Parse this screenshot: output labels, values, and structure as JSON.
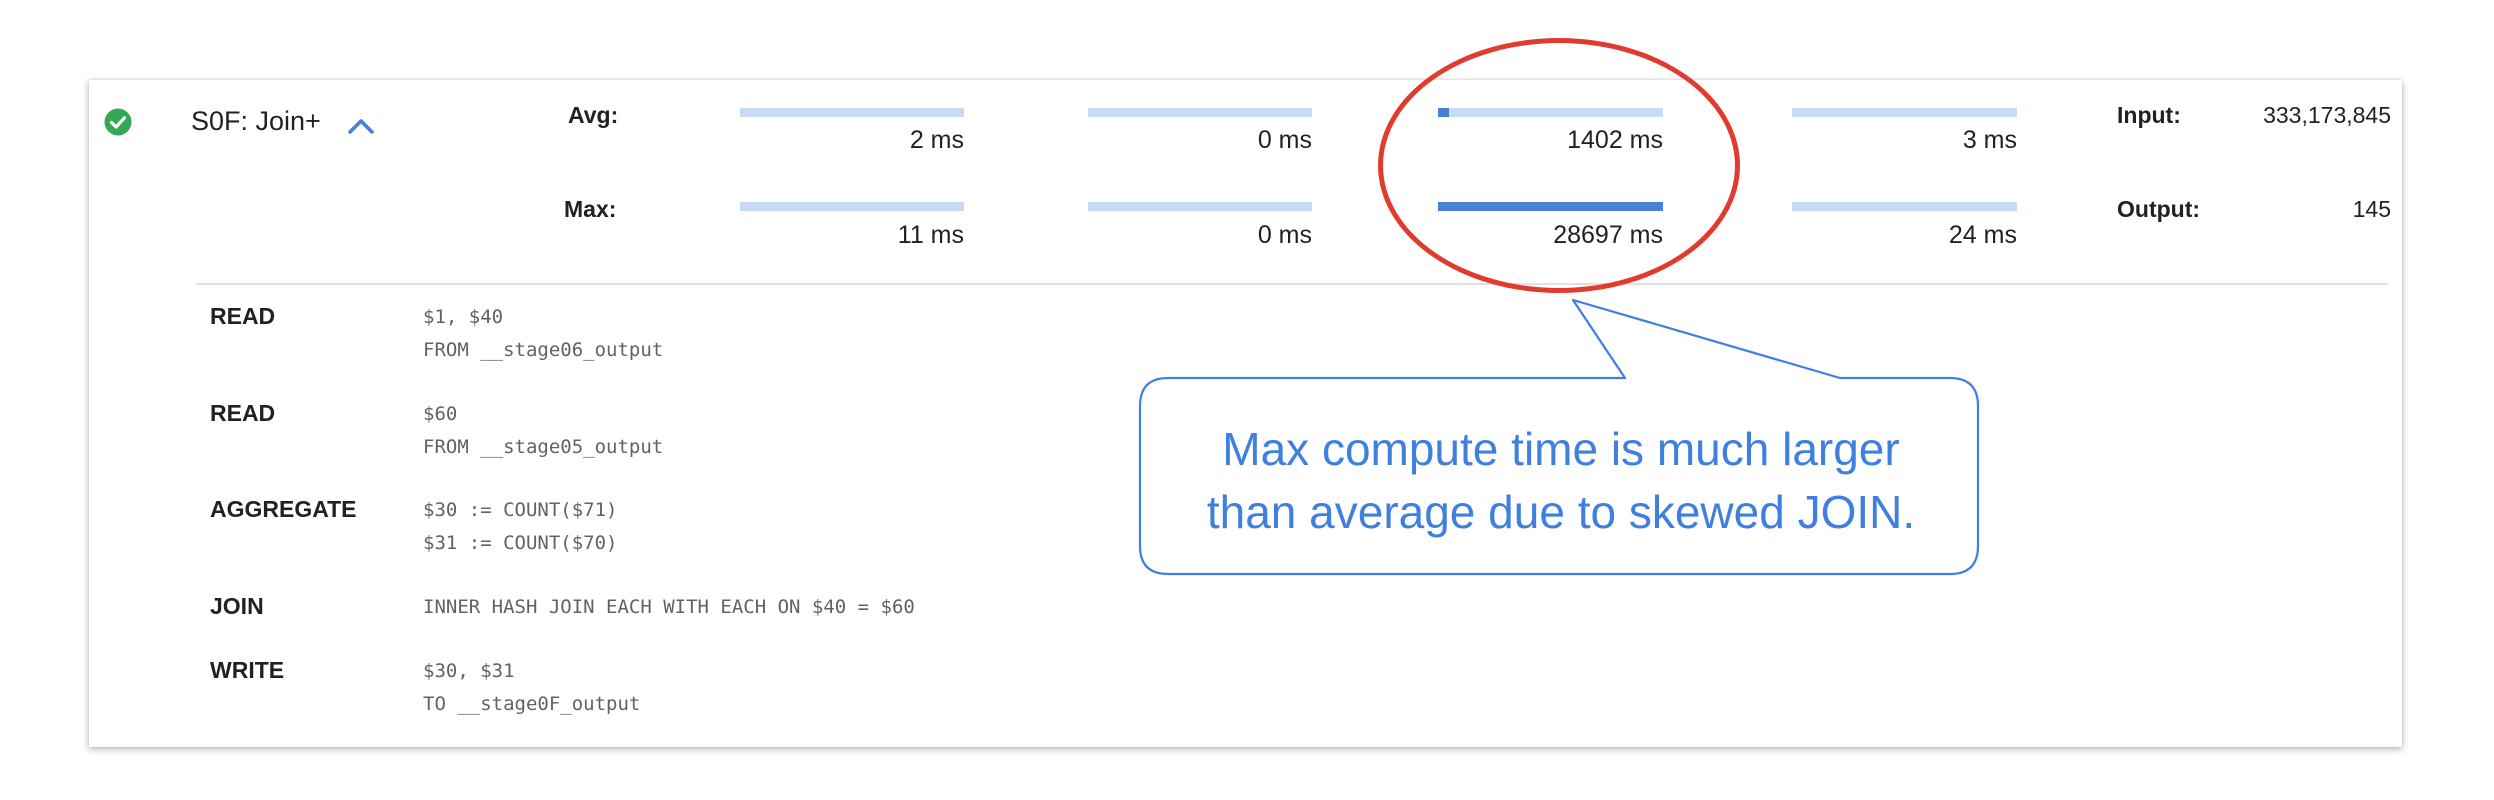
{
  "stage": {
    "title": "S0F: Join+",
    "status_icon": "check-circle-icon",
    "expand_icon": "chevron-up-icon",
    "status_color": "#34a853",
    "accent_color": "#4a7fd6"
  },
  "timing": {
    "rows": [
      {
        "label": "Avg:",
        "bars": [
          {
            "value": "2 ms",
            "fraction": 0.0014
          },
          {
            "value": "0 ms",
            "fraction": 0
          },
          {
            "value": "1402 ms",
            "fraction": 0.049
          },
          {
            "value": "3 ms",
            "fraction": 0.0021
          }
        ]
      },
      {
        "label": "Max:",
        "bars": [
          {
            "value": "11 ms",
            "fraction": 0.0004
          },
          {
            "value": "0 ms",
            "fraction": 0
          },
          {
            "value": "28697 ms",
            "fraction": 1.0
          },
          {
            "value": "24 ms",
            "fraction": 0.0008
          }
        ]
      }
    ]
  },
  "io": {
    "input_label": "Input:",
    "input_value": "333,173,845",
    "output_label": "Output:",
    "output_value": "145"
  },
  "steps": [
    {
      "name": "READ",
      "code": "$1, $40\nFROM __stage06_output"
    },
    {
      "name": "READ",
      "code": "$60\nFROM __stage05_output"
    },
    {
      "name": "AGGREGATE",
      "code": "$30 := COUNT($71)\n$31 := COUNT($70)"
    },
    {
      "name": "JOIN",
      "code": "INNER HASH JOIN EACH WITH EACH ON $40 = $60"
    },
    {
      "name": "WRITE",
      "code": "$30, $31\nTO __stage0F_output"
    }
  ],
  "annotation": {
    "line1": "Max compute time is much larger",
    "line2": "than average due to skewed JOIN.",
    "highlight_color": "#e13b2f",
    "callout_color": "#3e7fe0"
  }
}
